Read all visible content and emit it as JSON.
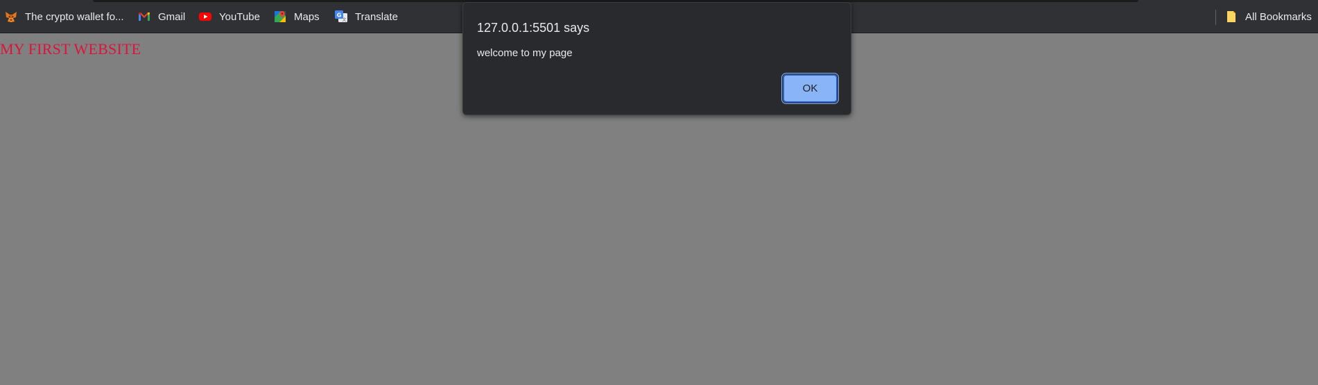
{
  "bookmarks_bar": {
    "items": [
      {
        "label": "The crypto wallet fo...",
        "icon": "fox-icon"
      },
      {
        "label": "Gmail",
        "icon": "gmail-icon"
      },
      {
        "label": "YouTube",
        "icon": "youtube-icon"
      },
      {
        "label": "Maps",
        "icon": "maps-icon"
      },
      {
        "label": "Translate",
        "icon": "translate-icon"
      }
    ],
    "all_bookmarks": {
      "label": "All Bookmarks",
      "icon": "folder-icon"
    }
  },
  "page": {
    "heading": "MY FIRST WEBSITE",
    "heading_color": "#dc143c",
    "background_color": "#808080"
  },
  "alert": {
    "title": "127.0.0.1:5501 says",
    "message": "welcome to my page",
    "ok_label": "OK",
    "accent_color": "#8ab4f8"
  }
}
